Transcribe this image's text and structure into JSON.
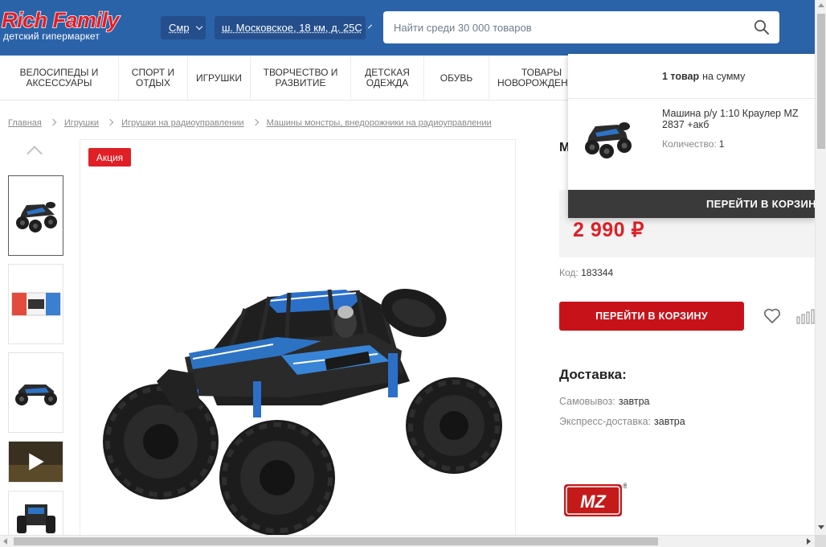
{
  "header": {
    "logo_main": "Rich Family",
    "logo_sub": "детский гипермаркет",
    "city": "Смр",
    "address": "ш. Московское, 18 км, д. 25С",
    "search_placeholder": "Найти среди 30 000 товаров"
  },
  "nav": {
    "items": [
      {
        "label": "ВЕЛОСИПЕДЫ И АКСЕССУАРЫ"
      },
      {
        "label": "СПОРТ И ОТДЫХ"
      },
      {
        "label": "ИГРУШКИ"
      },
      {
        "label": "ТВОРЧЕСТВО И РАЗВИТИЕ"
      },
      {
        "label": "ДЕТСКАЯ ОДЕЖДА"
      },
      {
        "label": "ОБУВЬ"
      },
      {
        "label": "ТОВАРЫ НОВОРОЖДЕННЫМ"
      }
    ]
  },
  "breadcrumbs": [
    "Главная",
    "Игрушки",
    "Игрушки на радиоуправлении",
    "Машины монстры, внедорожники на радиоуправлении"
  ],
  "product": {
    "sale_badge": "Акция",
    "title_fragment": "М",
    "price": "2 990 ₽",
    "code_label": "Код:",
    "code_value": "183344",
    "cart_button": "ПЕРЕЙТИ В КОРЗИНУ"
  },
  "delivery": {
    "title": "Доставка:",
    "rows": [
      {
        "label": "Самовывоз:",
        "value": "завтра"
      },
      {
        "label": "Экспресс-доставка:",
        "value": "завтра"
      }
    ]
  },
  "brand": {
    "logo_text": "MZ",
    "registered": "®"
  },
  "cart_popup": {
    "count_bold": "1 товар",
    "count_rest": "на сумму",
    "item_name": "Машина р/у 1:10 Краулер MZ 2837 +акб",
    "qty_label": "Количество:",
    "qty_value": "1",
    "button": "ПЕРЕЙТИ В КОРЗИНУ"
  },
  "colors": {
    "header_bg": "#2b63a9",
    "accent_red": "#e01f26",
    "cart_button_bg": "#c8121a",
    "popup_button_bg": "#3a3a3a"
  },
  "icons": [
    "search-icon",
    "chevron-down-icon",
    "chevron-up-icon",
    "heart-icon",
    "compare-icon",
    "play-icon"
  ]
}
